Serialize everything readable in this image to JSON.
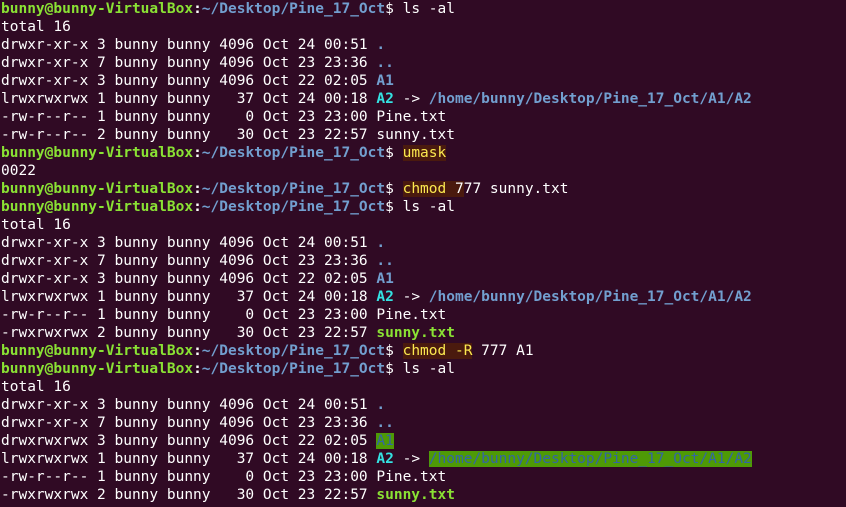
{
  "colors": {
    "background": "#300a24",
    "prompt_user": "#8ae234",
    "prompt_path": "#729fcf",
    "directory": "#729fcf",
    "symlink": "#34e2e2",
    "executable": "#8ae234",
    "other_writable_bg": "#4e9a06",
    "highlight_bg": "#4a1a0e",
    "highlight_fg": "#fce94f"
  },
  "lines": [
    {
      "segs": [
        {
          "t": "bunny@bunny-VirtualBox",
          "c": "user"
        },
        {
          "t": ":",
          "c": "colon"
        },
        {
          "t": "~/Desktop/Pine_17_Oct",
          "c": "path"
        },
        {
          "t": "$ ls -al",
          "c": "plain"
        }
      ]
    },
    {
      "segs": [
        {
          "t": "total 16",
          "c": "plain"
        }
      ]
    },
    {
      "segs": [
        {
          "t": "drwxr-xr-x 3 bunny bunny 4096 Oct 24 00:51 ",
          "c": "plain"
        },
        {
          "t": ".",
          "c": "dir"
        }
      ]
    },
    {
      "segs": [
        {
          "t": "drwxr-xr-x 7 bunny bunny 4096 Oct 23 23:36 ",
          "c": "plain"
        },
        {
          "t": "..",
          "c": "dir"
        }
      ]
    },
    {
      "segs": [
        {
          "t": "drwxr-xr-x 3 bunny bunny 4096 Oct 22 02:05 ",
          "c": "plain"
        },
        {
          "t": "A1",
          "c": "dir"
        }
      ]
    },
    {
      "segs": [
        {
          "t": "lrwxrwxrwx 1 bunny bunny   37 Oct 24 00:18 ",
          "c": "plain"
        },
        {
          "t": "A2",
          "c": "link"
        },
        {
          "t": " -> ",
          "c": "plain"
        },
        {
          "t": "/home/bunny/Desktop/Pine_17_Oct/A1/A2",
          "c": "link-target"
        }
      ]
    },
    {
      "segs": [
        {
          "t": "-rw-r--r-- 1 bunny bunny    0 Oct 23 23:00 Pine.txt",
          "c": "plain"
        }
      ]
    },
    {
      "segs": [
        {
          "t": "-rw-r--r-- 2 bunny bunny   30 Oct 23 22:57 sunny.txt",
          "c": "plain"
        }
      ]
    },
    {
      "segs": [
        {
          "t": "bunny@bunny-VirtualBox",
          "c": "user"
        },
        {
          "t": ":",
          "c": "colon"
        },
        {
          "t": "~/Desktop/Pine_17_Oct",
          "c": "path"
        },
        {
          "t": "$ ",
          "c": "plain"
        },
        {
          "t": "umask",
          "c": "hl-cmd"
        }
      ]
    },
    {
      "segs": [
        {
          "t": "0022",
          "c": "plain"
        }
      ]
    },
    {
      "segs": [
        {
          "t": "bunny@bunny-VirtualBox",
          "c": "user"
        },
        {
          "t": ":",
          "c": "colon"
        },
        {
          "t": "~/Desktop/Pine_17_Oct",
          "c": "path"
        },
        {
          "t": "$ ",
          "c": "plain"
        },
        {
          "t": "chmod",
          "c": "hl-cmd"
        },
        {
          "t": " ",
          "c": "hl-arg"
        },
        {
          "t": "7",
          "c": "hl-arg"
        },
        {
          "t": "77 sunny.txt",
          "c": "plain"
        }
      ]
    },
    {
      "segs": [
        {
          "t": "bunny@bunny-VirtualBox",
          "c": "user"
        },
        {
          "t": ":",
          "c": "colon"
        },
        {
          "t": "~/Desktop/Pine_17_Oct",
          "c": "path"
        },
        {
          "t": "$ ls -al",
          "c": "plain"
        }
      ]
    },
    {
      "segs": [
        {
          "t": "total 16",
          "c": "plain"
        }
      ]
    },
    {
      "segs": [
        {
          "t": "drwxr-xr-x 3 bunny bunny 4096 Oct 24 00:51 ",
          "c": "plain"
        },
        {
          "t": ".",
          "c": "dir"
        }
      ]
    },
    {
      "segs": [
        {
          "t": "drwxr-xr-x 7 bunny bunny 4096 Oct 23 23:36 ",
          "c": "plain"
        },
        {
          "t": "..",
          "c": "dir"
        }
      ]
    },
    {
      "segs": [
        {
          "t": "drwxr-xr-x 3 bunny bunny 4096 Oct 22 02:05 ",
          "c": "plain"
        },
        {
          "t": "A1",
          "c": "dir"
        }
      ]
    },
    {
      "segs": [
        {
          "t": "lrwxrwxrwx 1 bunny bunny   37 Oct 24 00:18 ",
          "c": "plain"
        },
        {
          "t": "A2",
          "c": "link"
        },
        {
          "t": " -> ",
          "c": "plain"
        },
        {
          "t": "/home/bunny/Desktop/Pine_17_Oct/A1/A2",
          "c": "link-target"
        }
      ]
    },
    {
      "segs": [
        {
          "t": "-rw-r--r-- 1 bunny bunny    0 Oct 23 23:00 Pine.txt",
          "c": "plain"
        }
      ]
    },
    {
      "segs": [
        {
          "t": "-rwxrwxrwx 2 bunny bunny   30 Oct 23 22:57 ",
          "c": "plain"
        },
        {
          "t": "sunny.txt",
          "c": "exec"
        }
      ]
    },
    {
      "segs": [
        {
          "t": "bunny@bunny-VirtualBox",
          "c": "user"
        },
        {
          "t": ":",
          "c": "colon"
        },
        {
          "t": "~/Desktop/Pine_17_Oct",
          "c": "path"
        },
        {
          "t": "$ ",
          "c": "plain"
        },
        {
          "t": "chmod",
          "c": "hl-cmd"
        },
        {
          "t": " ",
          "c": "hl-arg"
        },
        {
          "t": "-R",
          "c": "hl-opt"
        },
        {
          "t": " 777 A1",
          "c": "plain"
        }
      ]
    },
    {
      "segs": [
        {
          "t": "bunny@bunny-VirtualBox",
          "c": "user"
        },
        {
          "t": ":",
          "c": "colon"
        },
        {
          "t": "~/Desktop/Pine_17_Oct",
          "c": "path"
        },
        {
          "t": "$ ls -al",
          "c": "plain"
        }
      ]
    },
    {
      "segs": [
        {
          "t": "total 16",
          "c": "plain"
        }
      ]
    },
    {
      "segs": [
        {
          "t": "drwxr-xr-x 3 bunny bunny 4096 Oct 24 00:51 ",
          "c": "plain"
        },
        {
          "t": ".",
          "c": "dir"
        }
      ]
    },
    {
      "segs": [
        {
          "t": "drwxr-xr-x 7 bunny bunny 4096 Oct 23 23:36 ",
          "c": "plain"
        },
        {
          "t": "..",
          "c": "dir"
        }
      ]
    },
    {
      "segs": [
        {
          "t": "drwxrwxrwx 3 bunny bunny 4096 Oct 22 02:05 ",
          "c": "plain"
        },
        {
          "t": "A1",
          "c": "dir-ow"
        }
      ]
    },
    {
      "segs": [
        {
          "t": "lrwxrwxrwx 1 bunny bunny   37 Oct 24 00:18 ",
          "c": "plain"
        },
        {
          "t": "A2",
          "c": "link"
        },
        {
          "t": " -> ",
          "c": "plain"
        },
        {
          "t": "/home/bunny/Desktop/Pine_17_Oct/A1/A2",
          "c": "link-target-ow"
        }
      ]
    },
    {
      "segs": [
        {
          "t": "-rw-r--r-- 1 bunny bunny    0 Oct 23 23:00 Pine.txt",
          "c": "plain"
        }
      ]
    },
    {
      "segs": [
        {
          "t": "-rwxrwxrwx 2 bunny bunny   30 Oct 23 22:57 ",
          "c": "plain"
        },
        {
          "t": "sunny.txt",
          "c": "exec"
        }
      ]
    }
  ]
}
